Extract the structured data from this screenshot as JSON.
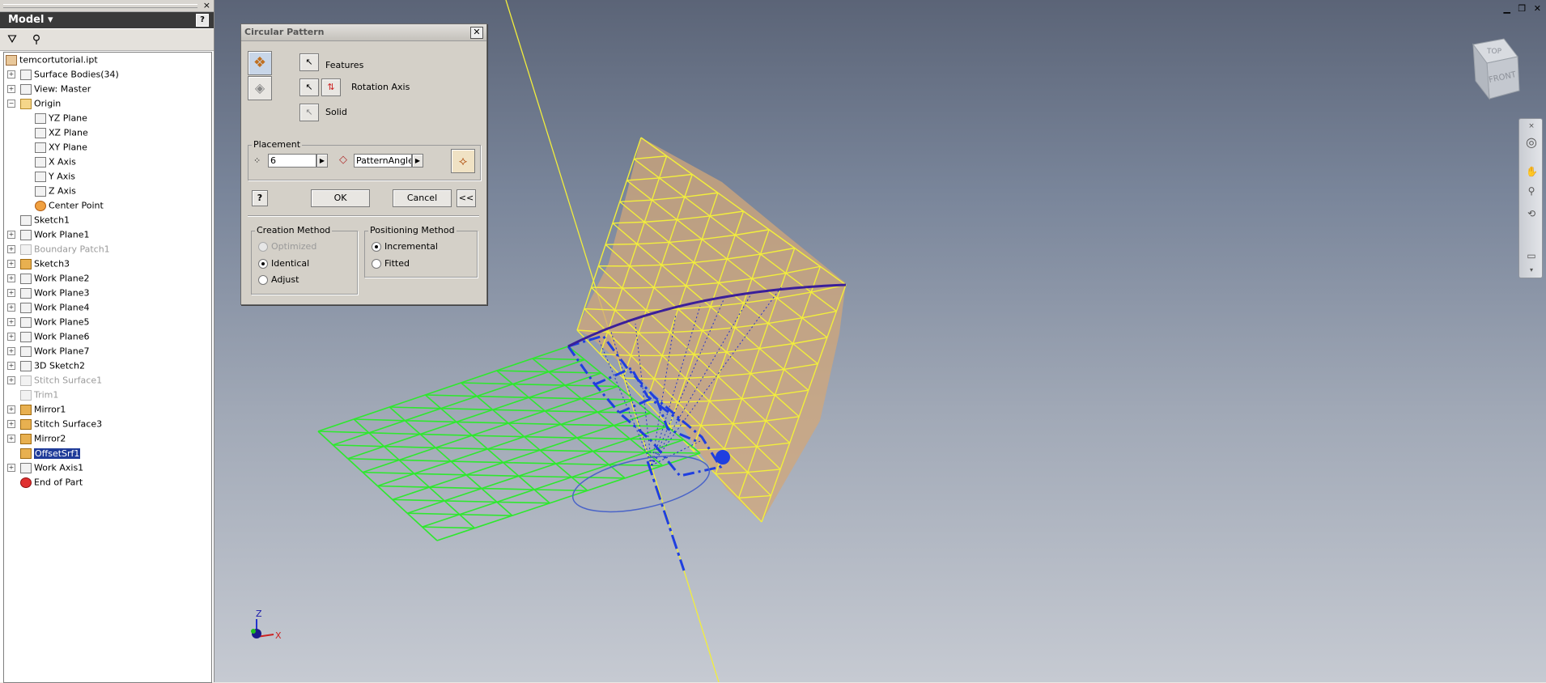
{
  "browser": {
    "title": "Model",
    "help": "?",
    "close": "×",
    "tree": [
      {
        "label": "temcortutorial.ipt",
        "state": "normal"
      },
      {
        "label": "Surface Bodies(34)",
        "state": "normal"
      },
      {
        "label": "View: Master",
        "state": "normal"
      },
      {
        "label": "Origin",
        "state": "normal"
      },
      {
        "label": "YZ Plane",
        "state": "normal"
      },
      {
        "label": "XZ Plane",
        "state": "normal"
      },
      {
        "label": "XY Plane",
        "state": "normal"
      },
      {
        "label": "X Axis",
        "state": "normal"
      },
      {
        "label": "Y Axis",
        "state": "normal"
      },
      {
        "label": "Z Axis",
        "state": "normal"
      },
      {
        "label": "Center Point",
        "state": "normal"
      },
      {
        "label": "Sketch1",
        "state": "normal"
      },
      {
        "label": "Work Plane1",
        "state": "normal"
      },
      {
        "label": "Boundary Patch1",
        "state": "dim"
      },
      {
        "label": "Sketch3",
        "state": "normal"
      },
      {
        "label": "Work Plane2",
        "state": "normal"
      },
      {
        "label": "Work Plane3",
        "state": "normal"
      },
      {
        "label": "Work Plane4",
        "state": "normal"
      },
      {
        "label": "Work Plane5",
        "state": "normal"
      },
      {
        "label": "Work Plane6",
        "state": "normal"
      },
      {
        "label": "Work Plane7",
        "state": "normal"
      },
      {
        "label": "3D Sketch2",
        "state": "normal"
      },
      {
        "label": "Stitch Surface1",
        "state": "dim"
      },
      {
        "label": "Trim1",
        "state": "dim"
      },
      {
        "label": "Mirror1",
        "state": "normal"
      },
      {
        "label": "Stitch Surface3",
        "state": "normal"
      },
      {
        "label": "Mirror2",
        "state": "normal"
      },
      {
        "label": "OffsetSrf1",
        "state": "selected"
      },
      {
        "label": "Work Axis1",
        "state": "normal"
      },
      {
        "label": "End of Part",
        "state": "normal"
      }
    ]
  },
  "dialog": {
    "title": "Circular Pattern",
    "features_label": "Features",
    "rotation_axis_label": "Rotation Axis",
    "solid_label": "Solid",
    "placement_label": "Placement",
    "count_value": "6",
    "angle_value": "PatternAngle",
    "help": "?",
    "ok": "OK",
    "cancel": "Cancel",
    "more": "<<",
    "creation_method": {
      "label": "Creation Method",
      "options": [
        "Optimized",
        "Identical",
        "Adjust"
      ],
      "selected": "Identical"
    },
    "positioning_method": {
      "label": "Positioning Method",
      "options": [
        "Incremental",
        "Fitted"
      ],
      "selected": "Incremental"
    }
  },
  "viewcube": {
    "top": "TOP",
    "front": "FRONT"
  },
  "triad": {
    "x": "X",
    "z": "Z"
  },
  "colors": {
    "yellow_mesh": "#f2ee3c",
    "green_mesh": "#2ee82e",
    "pattern_blue": "#1f3fe0",
    "surface_fill": "#d2a77a"
  }
}
